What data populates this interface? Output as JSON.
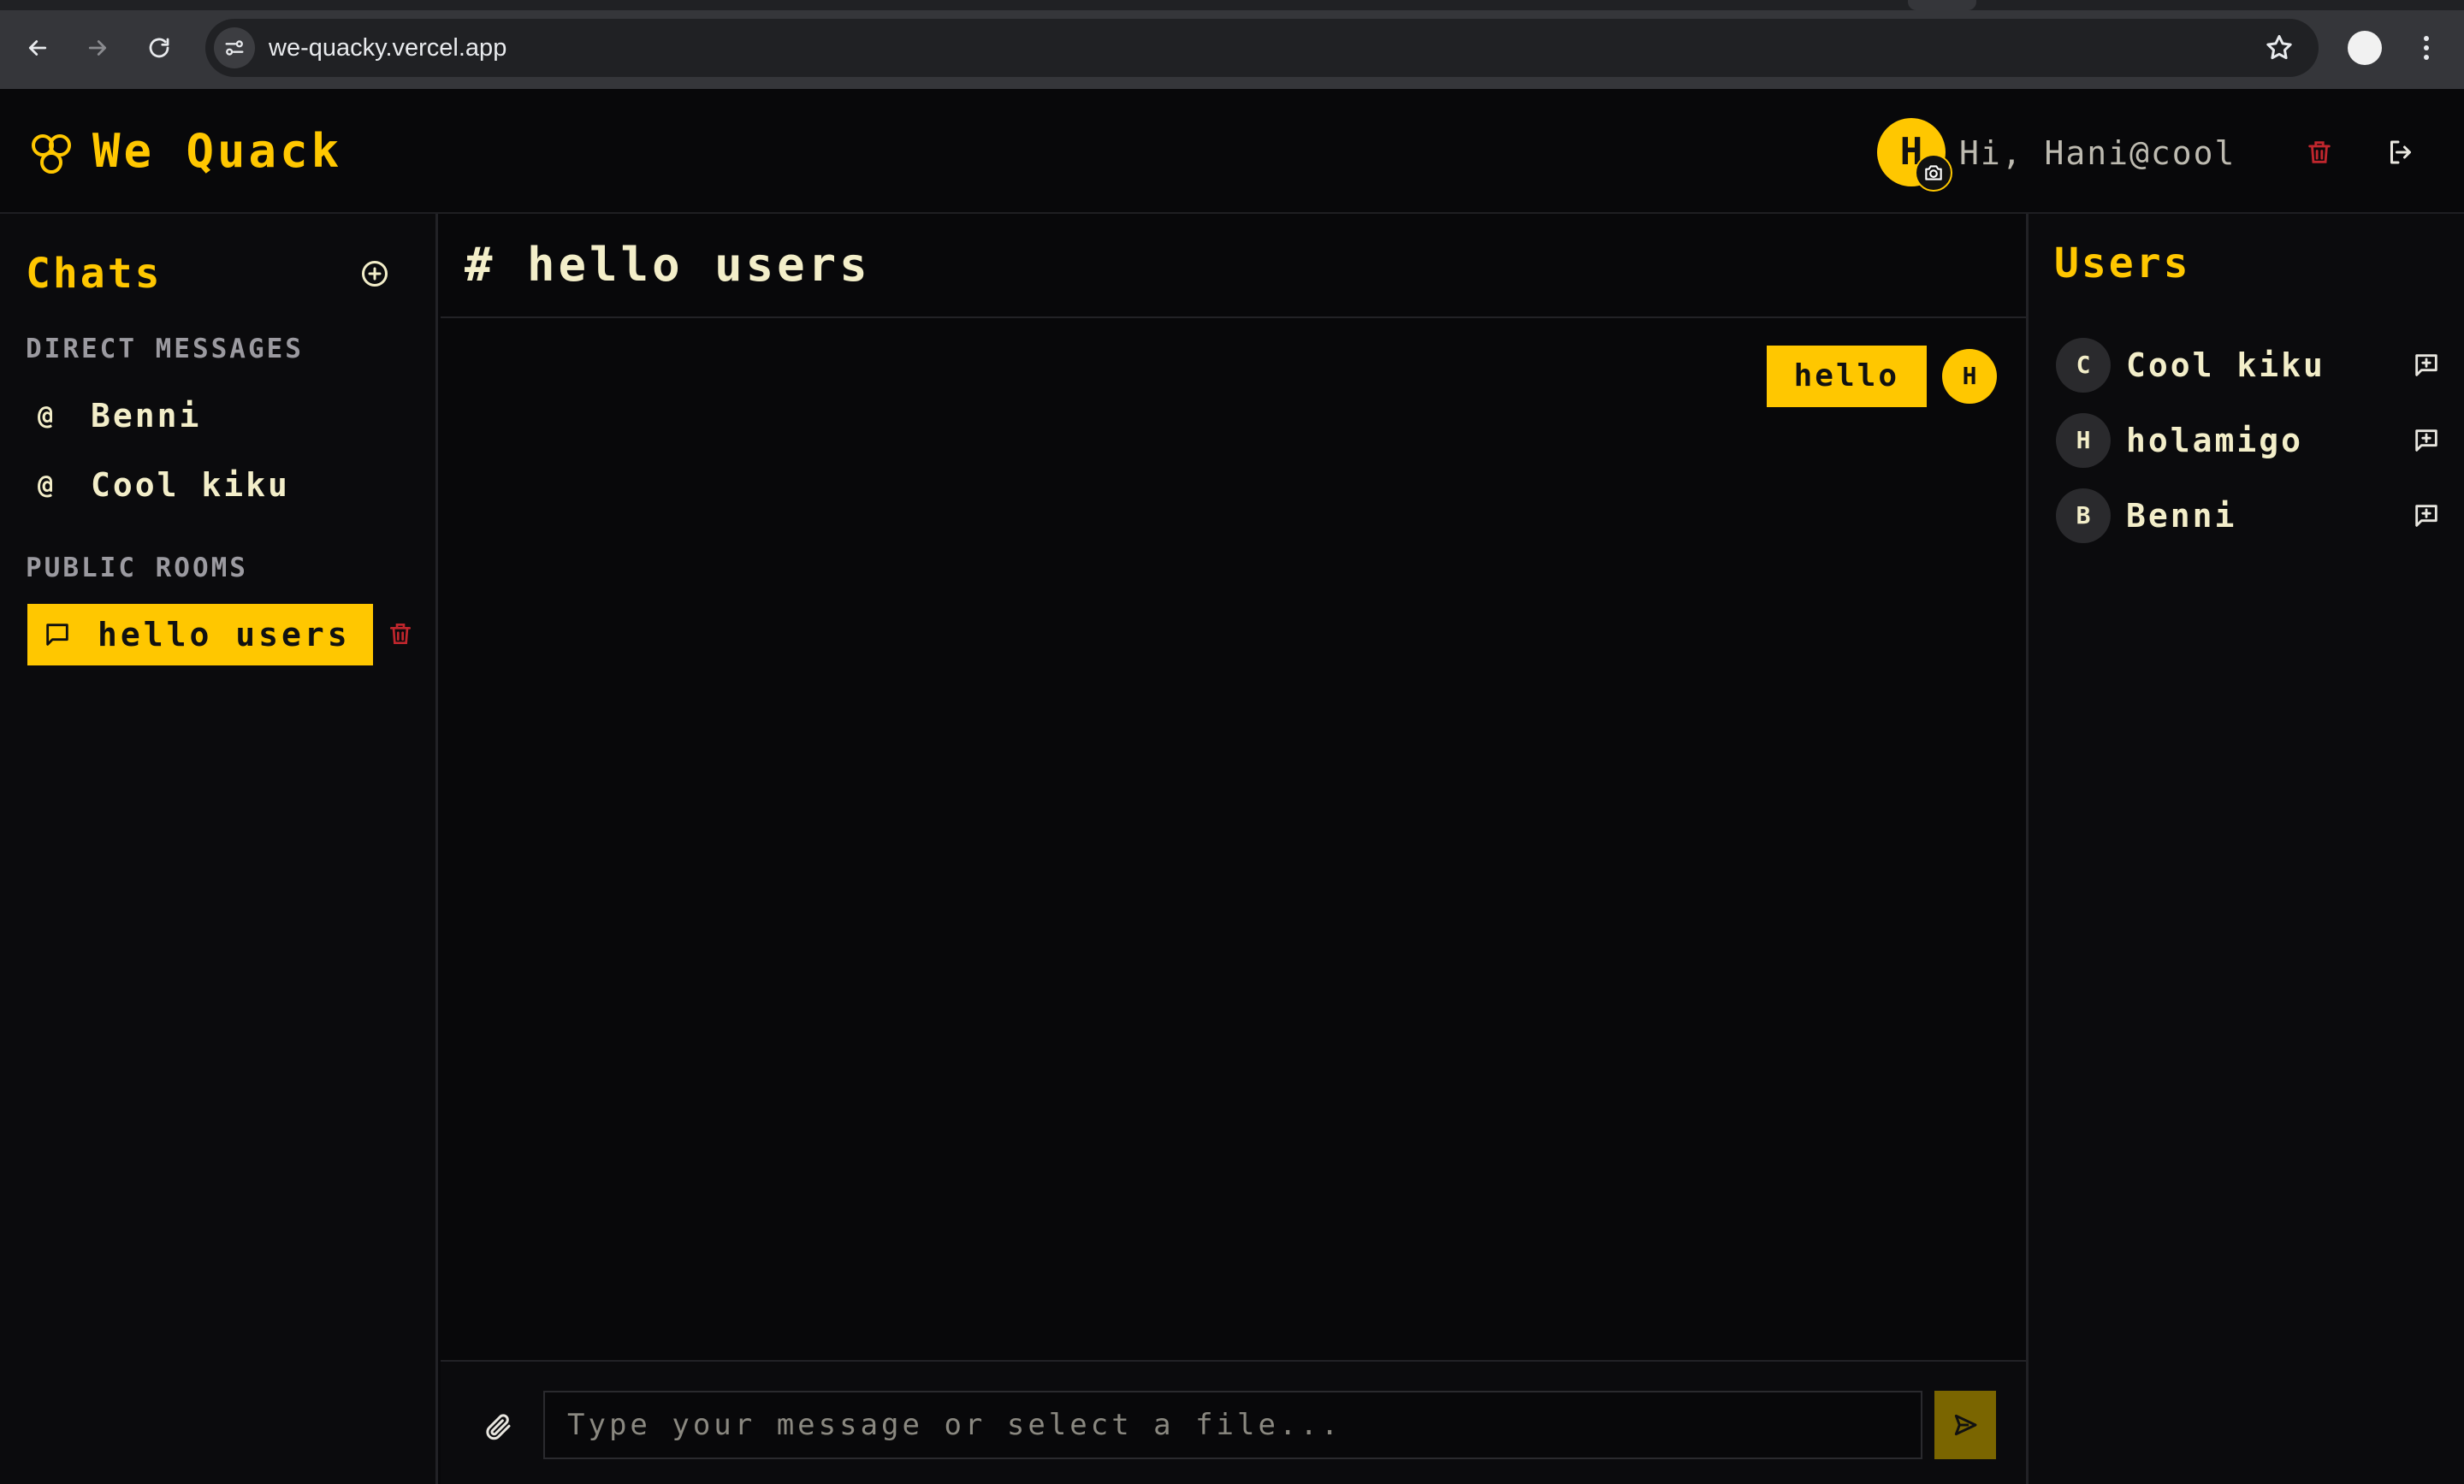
{
  "browser": {
    "url": "we-quacky.vercel.app"
  },
  "header": {
    "brand": "We Quack",
    "avatar_initial": "H",
    "greeting": "Hi, Hani@cool"
  },
  "sidebar": {
    "title": "Chats",
    "direct_messages_label": "DIRECT MESSAGES",
    "direct_messages": [
      {
        "prefix": "@",
        "name": "Benni"
      },
      {
        "prefix": "@",
        "name": "Cool kiku"
      }
    ],
    "public_rooms_label": "PUBLIC ROOMS",
    "rooms": [
      {
        "name": "hello users"
      }
    ]
  },
  "chat": {
    "title": "# hello users",
    "messages": [
      {
        "text": "hello",
        "avatar_initial": "H"
      }
    ],
    "input_placeholder": "Type your message or select a file..."
  },
  "users": {
    "title": "Users",
    "list": [
      {
        "initial": "C",
        "name": "Cool kiku"
      },
      {
        "initial": "H",
        "name": "holamigo"
      },
      {
        "initial": "B",
        "name": "Benni"
      }
    ]
  },
  "colors": {
    "accent": "#ffc700",
    "background": "#08080a",
    "danger": "#c0262d",
    "text": "#f3eec9"
  },
  "icons": {
    "back": "arrow-left-icon",
    "forward": "arrow-right-icon",
    "reload": "reload-icon",
    "site_settings": "tune-icon",
    "bookmark": "star-icon",
    "menu": "kebab-icon",
    "logo": "trefoil-logo-icon",
    "camera": "camera-icon",
    "trash": "trash-icon",
    "logout": "logout-icon",
    "add_chat": "plus-circle-icon",
    "room": "message-square-icon",
    "attach": "paperclip-icon",
    "send": "send-icon",
    "start_dm": "message-plus-icon"
  }
}
